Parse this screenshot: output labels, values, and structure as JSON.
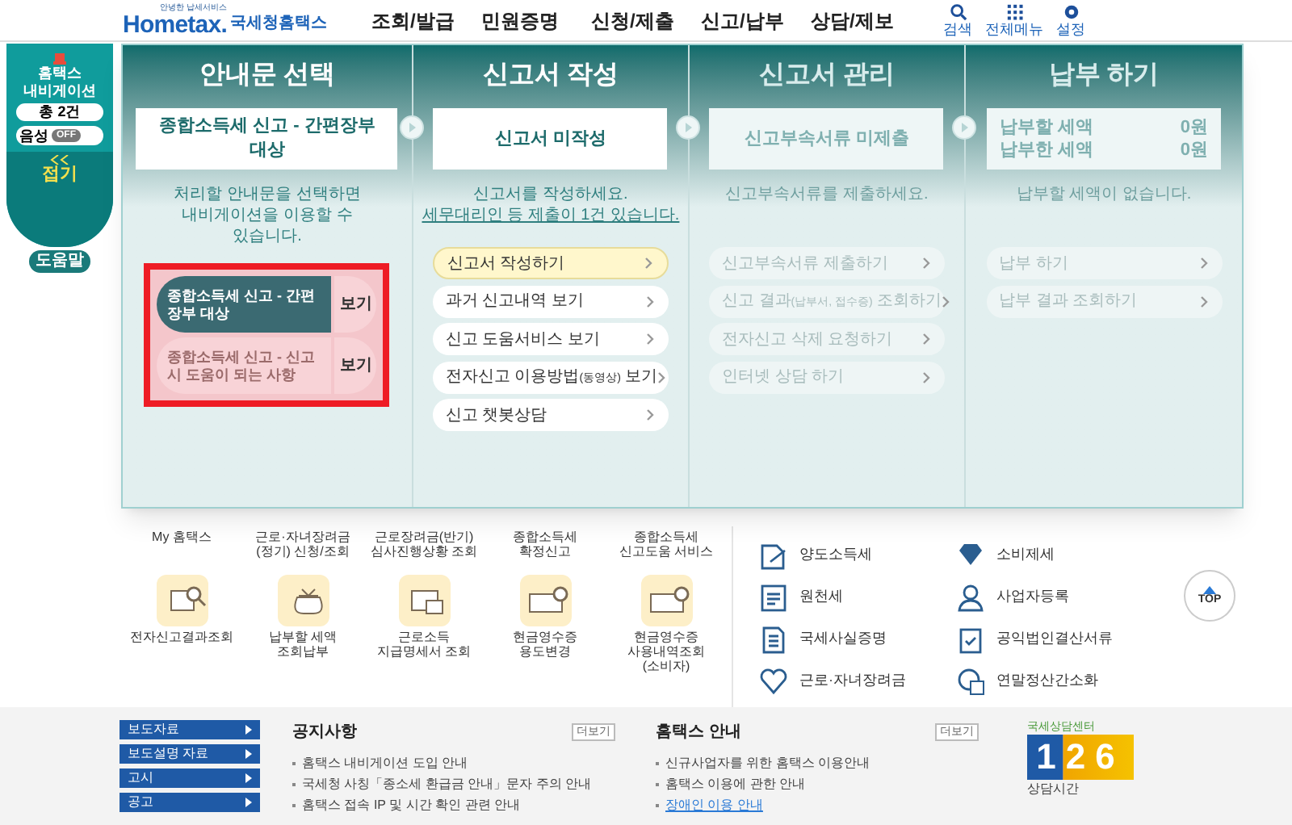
{
  "header": {
    "logo": {
      "tagline": "안녕한 납세서비스",
      "brand": "Hometax.",
      "name": "국세청홈택스"
    },
    "nav": [
      "조회/발급",
      "민원증명",
      "신청/제출",
      "신고/납부",
      "상담/제보"
    ],
    "tools": [
      {
        "kind": "search",
        "label": "검색"
      },
      {
        "kind": "menu",
        "label": "전체메뉴"
      },
      {
        "kind": "settings",
        "label": "설정"
      }
    ]
  },
  "navigator": {
    "title": "홈택스 내비게이션",
    "count": "총 2건",
    "voice": {
      "label": "음성",
      "on": false,
      "state": "OFF"
    },
    "collapse": "접기",
    "help": "도움말"
  },
  "panel": {
    "columns": [
      {
        "kind": "guide",
        "title": "안내문 선택",
        "active": true,
        "status": [
          "종합소득세 신고 - 간편장부 대상"
        ],
        "message": "처리할 안내문을 선택하면 내비게이션을 이용할 수 있습니다.",
        "items": [
          {
            "label": "종합소득세 신고 - 간편장부 대상",
            "button": "보기",
            "selected": true
          },
          {
            "label": "종합소득세 신고 - 신고 시 도움이 되는 사항",
            "button": "보기",
            "selected": false
          }
        ]
      },
      {
        "kind": "steps",
        "title": "신고서 작성",
        "active": true,
        "status": [
          "신고서 미작성"
        ],
        "message": "신고서를 작성하세요.",
        "link": "세무대리인 등 제출이 1건 있습니다.",
        "items": [
          {
            "label": "신고서 작성하기",
            "highlighted": true
          },
          {
            "label": "과거 신고내역 보기",
            "highlighted": false
          },
          {
            "label": "신고 도움서비스 보기",
            "highlighted": false
          },
          {
            "label": "전자신고 이용방법",
            "small": "(동영상)",
            "suffix": " 보기",
            "highlighted": false
          },
          {
            "label": "신고 챗봇상담",
            "highlighted": false
          }
        ]
      },
      {
        "kind": "steps",
        "title": "신고서 관리",
        "active": false,
        "status": [
          "신고부속서류 미제출"
        ],
        "message": "신고부속서류를 제출하세요.",
        "items": [
          {
            "label": "신고부속서류 제출하기",
            "highlighted": false
          },
          {
            "label": "신고 결과",
            "small": "(납부서, 접수증)",
            "suffix": " 조회하기",
            "highlighted": false
          },
          {
            "label": "전자신고 삭제 요청하기",
            "highlighted": false
          },
          {
            "label": "인터넷 상담 하기",
            "highlighted": false
          }
        ]
      },
      {
        "kind": "payment",
        "title": "납부 하기",
        "active": false,
        "amounts": [
          {
            "label": "납부할 세액",
            "value": "0원"
          },
          {
            "label": "납부한 세액",
            "value": "0원"
          }
        ],
        "message": "납부할 세액이 없습니다.",
        "items": [
          {
            "label": "납부 하기",
            "highlighted": false
          },
          {
            "label": "납부 결과 조회하기",
            "highlighted": false
          }
        ]
      }
    ]
  },
  "quick_services": [
    "My 홈택스",
    "근로·자녀장려금(정기) 신청/조회",
    "근로장려금(반기) 심사진행상황 조회",
    "종합소득세 확정신고",
    "종합소득세 신고도움 서비스",
    "전자신고결과조회",
    "납부할 세액 조회납부",
    "근로소득 지급명세서 조회",
    "현금영수증 용도변경",
    "현금영수증 사용내역조회 (소비자)"
  ],
  "tax_links": [
    "양도소득세",
    "소비제세",
    "원천세",
    "사업자등록",
    "국세사실증명",
    "공익법인결산서류",
    "근로·자녀장려금",
    "연말정산간소화"
  ],
  "top_button": "TOP",
  "footer": {
    "side_menu": [
      "보도자료",
      "보도설명 자료",
      "고시",
      "공고"
    ],
    "boards": [
      {
        "title": "공지사항",
        "more": "더보기",
        "items": [
          {
            "text": "홈택스 내비게이션 도입 안내",
            "link": false
          },
          {
            "text": "국세청 사칭「종소세 환급금 안내」문자 주의 안내",
            "link": false
          },
          {
            "text": "홈택스 접속 IP 및 시간 확인 관련 안내",
            "link": false
          }
        ]
      },
      {
        "title": "홈택스 안내",
        "more": "더보기",
        "items": [
          {
            "text": "신규사업자를 위한 홈택스 이용안내",
            "link": false
          },
          {
            "text": "홈택스 이용에 관한 안내",
            "link": false
          },
          {
            "text": "장애인 이용 안내",
            "link": true
          }
        ]
      }
    ],
    "center": {
      "caption": "국세상담센터",
      "number": "126",
      "hours": "상담시간"
    }
  }
}
